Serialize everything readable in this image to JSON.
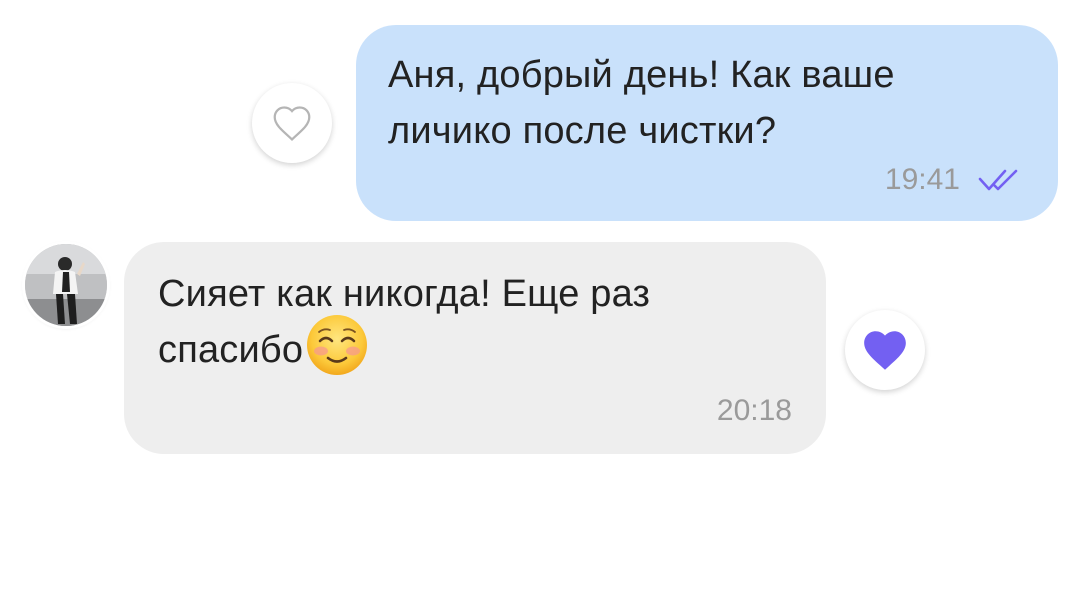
{
  "messages": [
    {
      "direction": "outgoing",
      "text_line1": "Аня, добрый день! Как ваше",
      "text_line2": "личико после чистки?",
      "time": "19:41",
      "status": "read",
      "liked": false
    },
    {
      "direction": "incoming",
      "text_line1": "Сияет как никогда! Еще раз",
      "text_line2": "спасибо",
      "emoji": "smiling-face-with-blushing-cheeks",
      "time": "20:18",
      "liked": true
    }
  ],
  "colors": {
    "outgoing_bubble": "#c9e1fb",
    "incoming_bubble": "#eeeeee",
    "accent": "#7360f2",
    "timestamp": "#9a9a9a"
  },
  "icons": {
    "empty_like": "heart-outline-icon",
    "filled_like": "heart-filled-icon",
    "read_status": "double-check-icon"
  }
}
